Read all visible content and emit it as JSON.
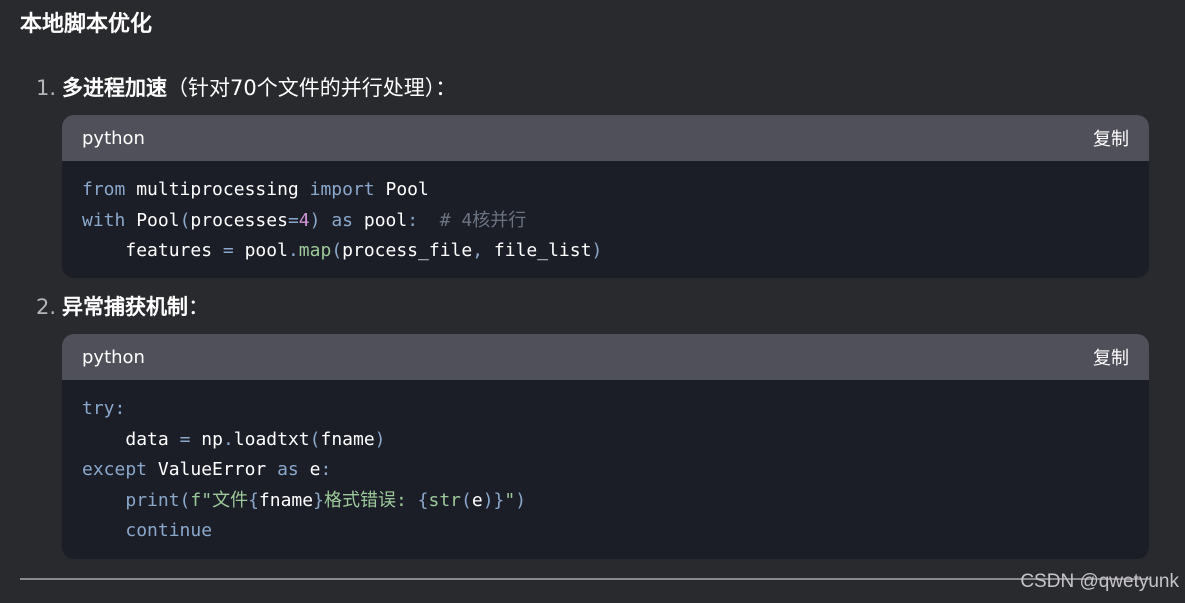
{
  "section": {
    "title": "本地脚本优化"
  },
  "items": [
    {
      "number": "1.",
      "title": "多进程加速",
      "rest": "（针对70个文件的并行处理）：",
      "code": {
        "language": "python",
        "copy_label": "复制",
        "lines": [
          "from multiprocessing import Pool",
          "with Pool(processes=4) as pool:  # 4核并行",
          "    features = pool.map(process_file, file_list)"
        ]
      }
    },
    {
      "number": "2.",
      "title": "异常捕获机制",
      "rest": "：",
      "code": {
        "language": "python",
        "copy_label": "复制",
        "lines": [
          "try:",
          "    data = np.loadtxt(fname)",
          "except ValueError as e:",
          "    print(f\"文件{fname}格式错误: {str(e)}\")",
          "    continue"
        ]
      }
    }
  ],
  "watermark": "CSDN @qwetyunk",
  "colors": {
    "background": "#292a2d",
    "code_background": "#1b1e27",
    "code_header": "#50505a",
    "keyword": "#8aa8cc",
    "number": "#d195d9",
    "function": "#9cc99a",
    "comment": "#6b7382"
  }
}
